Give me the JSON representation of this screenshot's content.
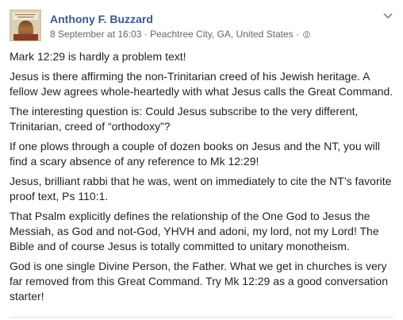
{
  "post": {
    "author": "Anthony F. Buzzard",
    "timestamp": "8 September at 16:03",
    "location": "Peachtree City, GA, United States",
    "separator": "·",
    "privacy_icon": "globe-icon",
    "menu_icon": "chevron-down-icon",
    "avatar_icon": "book-cover-avatar",
    "paragraphs": [
      "Mark 12:29 is hardly a problem text!",
      "Jesus is there affirming the non-Trinitarian creed of his Jewish heritage. A fellow Jew agrees whole-heartedly with what Jesus calls the Great Command.",
      "The interesting question is: Could Jesus subscribe to the very different, Trinitarian, creed of “orthodoxy”?",
      "If one plows through a couple of dozen books on Jesus and the NT, you will find a scary absence of any reference to Mk 12:29!",
      "Jesus, brilliant rabbi that he was, went on immediately to cite the NT’s favorite proof text, Ps 110:1.",
      "That Psalm explicitly defines the relationship of the One God to Jesus the Messiah, as God and not-God, YHVH and adoni, my lord, not my Lord! The Bible and of course Jesus is totally committed to unitary monotheism.",
      "God is one single Divine Person, the Father. What we get in churches is very far removed from this Great Command. Try Mk 12:29 as a good conversation starter!"
    ]
  },
  "colors": {
    "author_link": "#365899",
    "meta_text": "#606770",
    "body_text": "#1d2129",
    "divider": "#dadde1"
  }
}
